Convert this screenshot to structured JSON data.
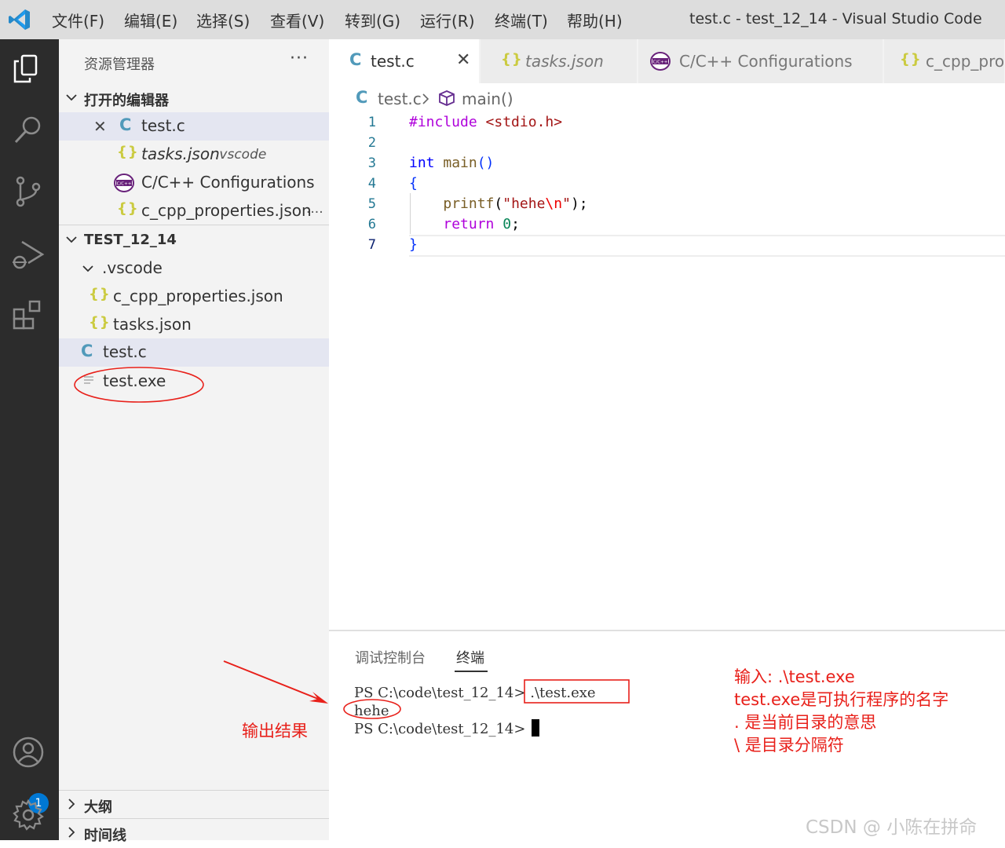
{
  "menu": {
    "items": [
      "文件(F)",
      "编辑(E)",
      "选择(S)",
      "查看(V)",
      "转到(G)",
      "运行(R)",
      "终端(T)",
      "帮助(H)"
    ],
    "window_title": "test.c - test_12_14 - Visual Studio Code"
  },
  "activity_bar": {
    "icons": [
      "explorer-icon",
      "search-icon",
      "source-control-icon",
      "run-debug-icon",
      "extensions-icon",
      "accounts-icon",
      "settings-gear-icon"
    ],
    "accounts_badge": "1"
  },
  "sidebar": {
    "title": "资源管理器",
    "more": "···",
    "open_editors": {
      "header": "打开的编辑器",
      "items": [
        {
          "name": "test.c",
          "detail": ""
        },
        {
          "name": "tasks.json",
          "detail": ".vscode"
        },
        {
          "name": "C/C++ Configurations",
          "detail": ""
        },
        {
          "name": "c_cpp_properties.json",
          "detail": "...."
        }
      ]
    },
    "folder": {
      "header": "TEST_12_14",
      "vscode_folder": ".vscode",
      "files": [
        "c_cpp_properties.json",
        "tasks.json",
        "test.c",
        "test.exe"
      ]
    },
    "outline_header": "大纲",
    "timeline_header": "时间线"
  },
  "tabs": [
    {
      "label": "test.c",
      "active": true
    },
    {
      "label": "tasks.json",
      "active": false
    },
    {
      "label": "C/C++ Configurations",
      "active": false
    },
    {
      "label": "c_cpp_prop",
      "active": false
    }
  ],
  "breadcrumb": {
    "file": "test.c",
    "symbol": "main()"
  },
  "editor": {
    "line_numbers": [
      "1",
      "2",
      "3",
      "4",
      "5",
      "6",
      "7"
    ],
    "code": {
      "l1_pre": "#include",
      "l1_inc": "<stdio.h>",
      "l3_type": "int",
      "l3_fn": "main",
      "l3_paren": "()",
      "l4_brace": "{",
      "l5_fn": "printf",
      "l5_open": "(",
      "l5_str1": "\"hehe",
      "l5_esc": "\\n",
      "l5_str2": "\"",
      "l5_close": ");",
      "l6_kw": "return",
      "l6_num": "0",
      "l6_semi": ";",
      "l7_brace": "}"
    }
  },
  "panel": {
    "tabs": [
      "调试控制台",
      "终端"
    ],
    "terminal": {
      "line1_prompt": "PS C:\\code\\test_12_14>",
      "line1_cmd": ".\\test.exe",
      "line2": "hehe",
      "line3_prompt": "PS C:\\code\\test_12_14>"
    }
  },
  "annotations": {
    "output_label": "输出结果",
    "note_lines": [
      "输入: .\\test.exe",
      "test.exe是可执行程序的名字",
      ".  是当前目录的意思",
      "\\ 是目录分隔符"
    ],
    "color": "#e8201a"
  },
  "watermark": "CSDN @ 小陈在拼命"
}
